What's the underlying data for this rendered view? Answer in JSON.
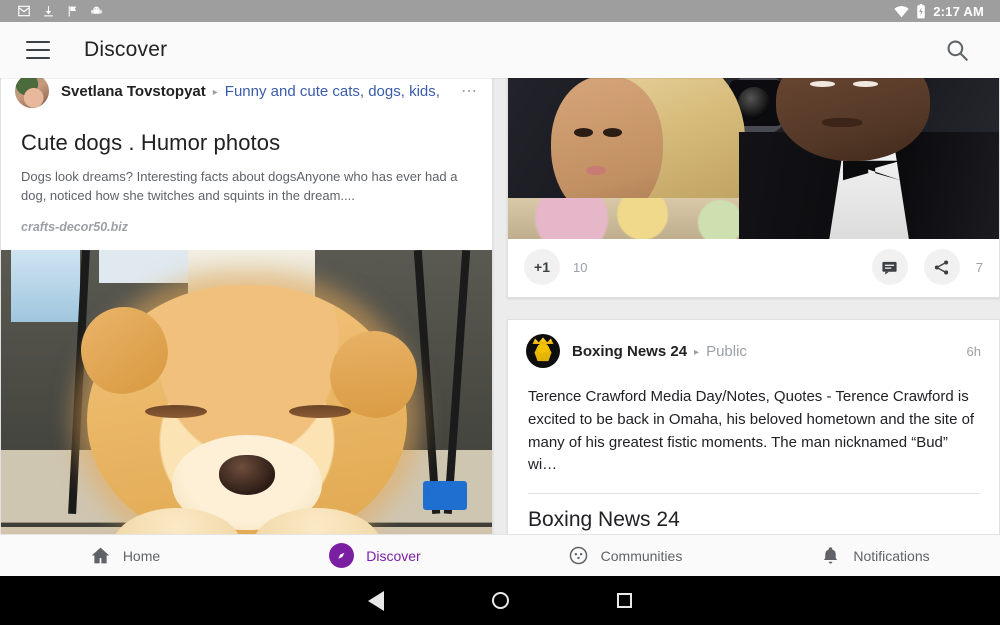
{
  "statusbar": {
    "time": "2:17 AM",
    "left_icons": [
      "gmail-icon",
      "download-icon",
      "flag-check-icon",
      "android-head-icon"
    ],
    "right_icons": [
      "wifi-icon",
      "battery-charging-icon"
    ]
  },
  "appbar": {
    "menu_icon": "hamburger-menu-icon",
    "title": "Discover",
    "search_icon": "search-icon"
  },
  "left_column": {
    "card": {
      "author": "Svetlana Tovstopyat",
      "separator": "▸",
      "community": "Funny and cute cats, dogs, kids,",
      "overflow": "⋯",
      "article_title": "Cute dogs . Humor photos",
      "article_snippet": "Dogs look dreams? Interesting facts about dogsAnyone who has ever had a dog, noticed how she twitches and squints in the dream....",
      "article_domain": "crafts-decor50.biz",
      "photo_alt": "sleeping-pomeranian-dog-photo"
    }
  },
  "right_column": {
    "cards": [
      {
        "photo_alt": "celebrity-couple-red-carpet-photo",
        "actions": {
          "plusone_label": "+1",
          "plusone_count": "10",
          "comment_icon": "comment-icon",
          "share_icon": "share-icon",
          "share_count": "7"
        }
      },
      {
        "author": "Boxing News 24",
        "separator": "▸",
        "visibility": "Public",
        "time": "6h",
        "body": "Terence Crawford Media Day/Notes, Quotes - Terence Crawford is excited to be back in Omaha, his beloved hometown and the site of many of his greatest fistic moments. The man nicknamed “Bud” wi…",
        "link_title": "Boxing News 24"
      }
    ]
  },
  "bottom_nav": {
    "items": [
      {
        "label": "Home",
        "icon": "home-icon",
        "active": false
      },
      {
        "label": "Discover",
        "icon": "compass-icon",
        "active": true
      },
      {
        "label": "Communities",
        "icon": "communities-icon",
        "active": false
      },
      {
        "label": "Notifications",
        "icon": "bell-icon",
        "active": false
      }
    ]
  },
  "system_nav": {
    "back": "back-triangle-icon",
    "home": "home-circle-icon",
    "recents": "recents-square-icon"
  },
  "colors": {
    "accent": "#7b1fa2",
    "link": "#3b5ca8",
    "statusbar_bg": "#9e9e9e",
    "appbar_bg": "#fafafa",
    "page_bg": "#ececec"
  }
}
